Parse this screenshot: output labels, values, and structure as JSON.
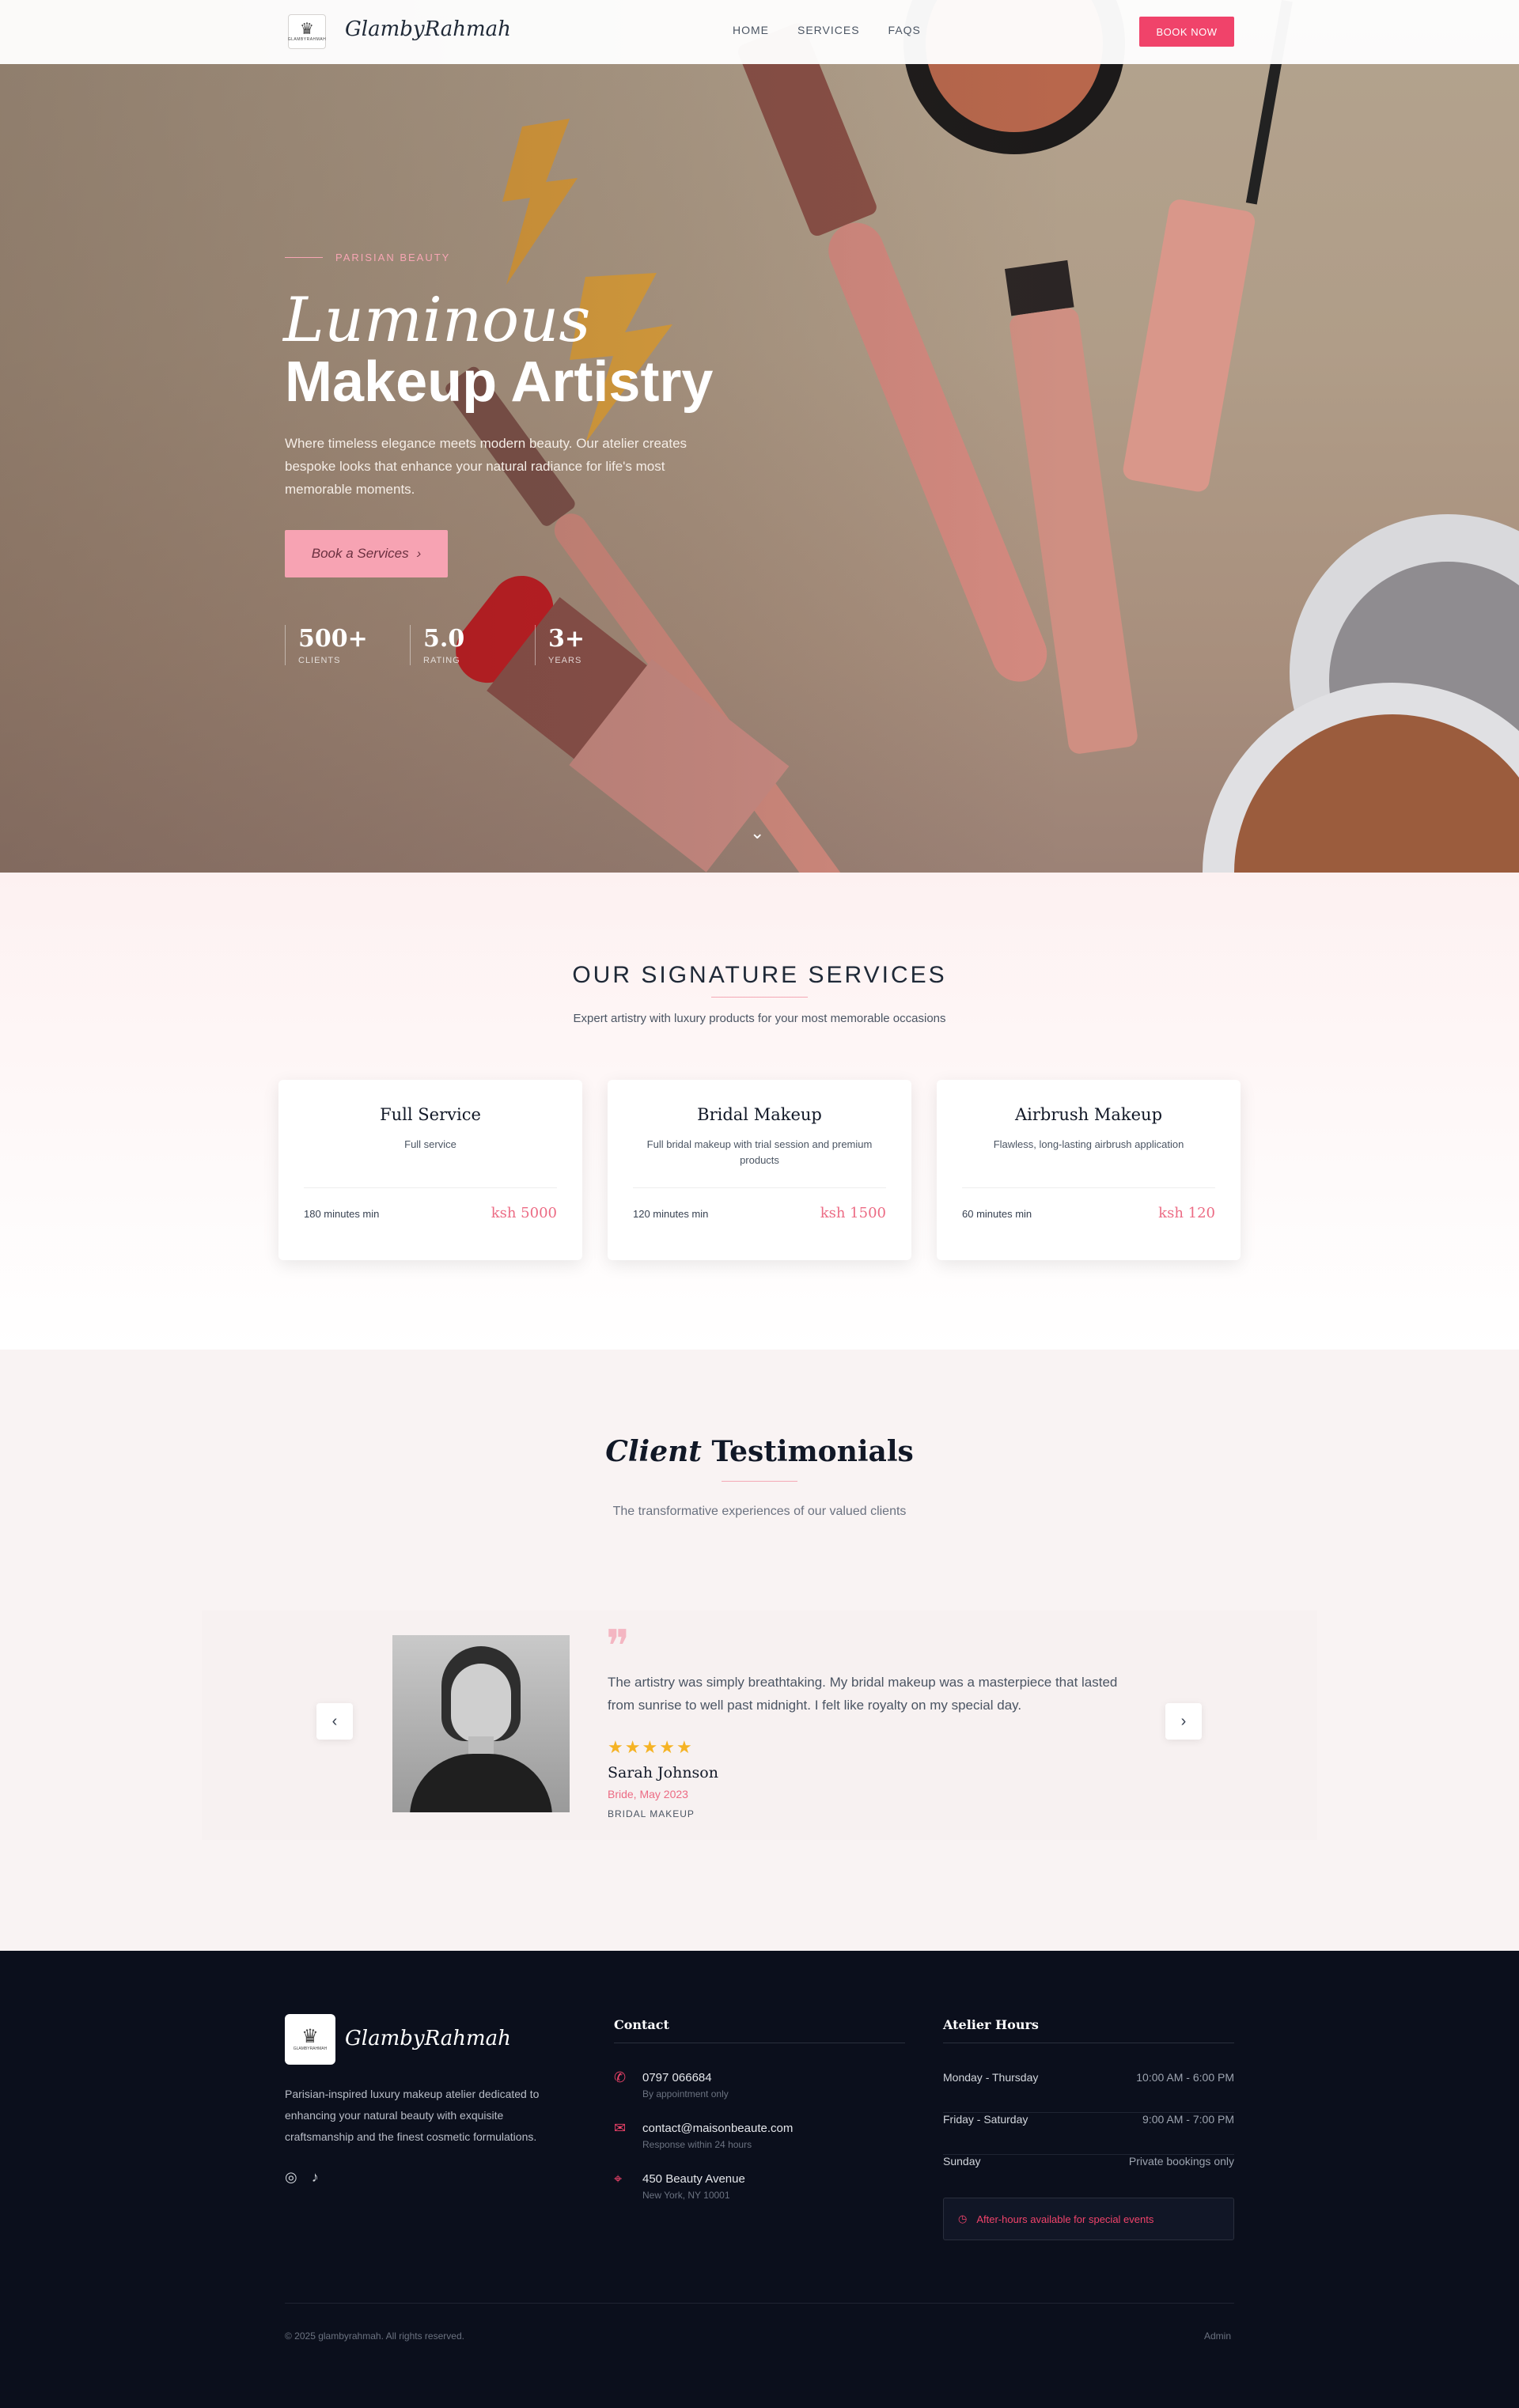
{
  "nav": {
    "brand": "GlambyRahmah",
    "logo_text": "GLAMBYRAHMAH",
    "links": [
      "HOME",
      "SERVICES",
      "FAQS"
    ],
    "cta": "BOOK NOW"
  },
  "hero": {
    "eyebrow": "PARISIAN BEAUTY",
    "title_italic": "Luminous",
    "title_bold": "Makeup Artistry",
    "description": "Where timeless elegance meets modern beauty. Our atelier creates bespoke looks that enhance your natural radiance for life's most memorable moments.",
    "button": "Book a Services",
    "stats": [
      {
        "value": "500+",
        "label": "CLIENTS"
      },
      {
        "value": "5.0",
        "label": "RATING"
      },
      {
        "value": "3+",
        "label": "YEARS"
      }
    ]
  },
  "services": {
    "title": "OUR SIGNATURE SERVICES",
    "subtitle": "Expert artistry with luxury products for your most memorable occasions",
    "items": [
      {
        "name": "Full Service",
        "description": "Full service",
        "duration": "180 minutes min",
        "price": "ksh 5000"
      },
      {
        "name": "Bridal Makeup",
        "description": "Full bridal makeup with trial session and premium products",
        "duration": "120 minutes min",
        "price": "ksh 1500"
      },
      {
        "name": "Airbrush Makeup",
        "description": "Flawless, long-lasting airbrush application",
        "duration": "60 minutes min",
        "price": "ksh 120"
      }
    ]
  },
  "testimonials": {
    "title_italic": "Client",
    "title_rest": "Testimonials",
    "subtitle": "The transformative experiences of our valued clients",
    "quote": "The artistry was simply breathtaking. My bridal makeup was a masterpiece that lasted from sunrise to well past midnight. I felt like royalty on my special day.",
    "rating": 5,
    "author": "Sarah Johnson",
    "meta": "Bride, May 2023",
    "tag": "BRIDAL MAKEUP"
  },
  "footer": {
    "brand": "GlambyRahmah",
    "about": "Parisian-inspired luxury makeup atelier dedicated to enhancing your natural beauty with exquisite craftsmanship and the finest cosmetic formulations.",
    "contact_heading": "Contact",
    "contacts": [
      {
        "icon": "phone-icon",
        "main": "0797 066684",
        "sub": "By appointment only"
      },
      {
        "icon": "mail-icon",
        "main": "contact@maisonbeaute.com",
        "sub": "Response within 24 hours"
      },
      {
        "icon": "map-pin-icon",
        "main": "450 Beauty Avenue",
        "sub": "New York, NY 10001"
      }
    ],
    "hours_heading": "Atelier Hours",
    "hours": [
      {
        "days": "Monday - Thursday",
        "time": "10:00 AM - 6:00 PM"
      },
      {
        "days": "Friday - Saturday",
        "time": "9:00 AM - 7:00 PM"
      },
      {
        "days": "Sunday",
        "time": "Private bookings only"
      }
    ],
    "after_hours": "After-hours available for special events",
    "copyright": "© 2025 glambyrahmah. All rights reserved.",
    "admin": "Admin"
  },
  "colors": {
    "accent": "#f0436a",
    "accent_soft": "#f7a3b3",
    "footer_bg": "#0b0f1c",
    "star": "#f5b324"
  }
}
